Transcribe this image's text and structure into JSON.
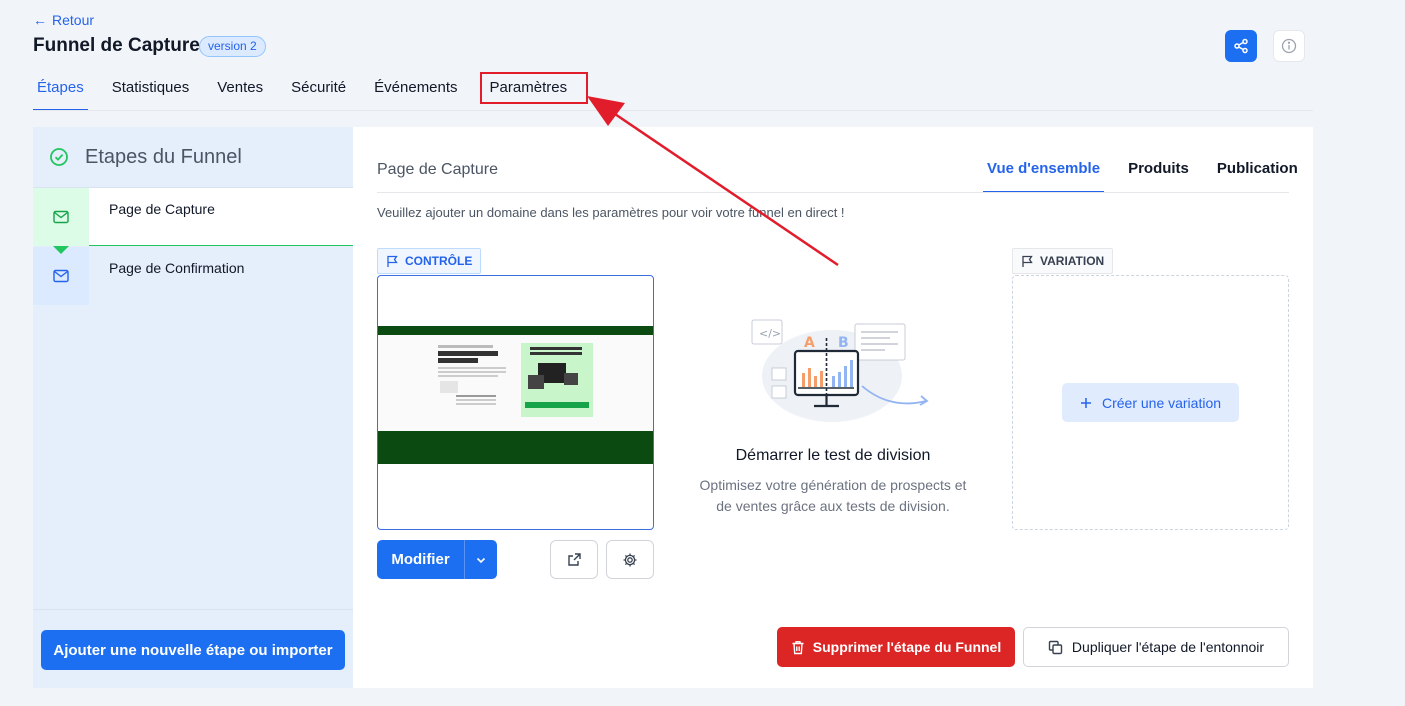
{
  "header": {
    "back_label": "Retour",
    "title": "Funnel de Capture",
    "version_badge": "version 2"
  },
  "top_tabs": [
    {
      "label": "Étapes",
      "active": true
    },
    {
      "label": "Statistiques",
      "active": false
    },
    {
      "label": "Ventes",
      "active": false
    },
    {
      "label": "Sécurité",
      "active": false
    },
    {
      "label": "Événements",
      "active": false
    },
    {
      "label": "Paramètres",
      "active": false,
      "highlighted": true
    }
  ],
  "sidebar": {
    "title": "Etapes du Funnel",
    "steps": [
      {
        "label": "Page de Capture",
        "selected": true
      },
      {
        "label": "Page de Confirmation",
        "selected": false
      }
    ],
    "add_button": "Ajouter une nouvelle étape ou importer"
  },
  "main": {
    "page_title": "Page de Capture",
    "tabs": [
      {
        "label": "Vue d'ensemble",
        "active": true
      },
      {
        "label": "Produits",
        "active": false
      },
      {
        "label": "Publication",
        "active": false
      }
    ],
    "notice": "Veuillez ajouter un domaine dans les paramètres pour voir votre funnel en direct !",
    "control_tag": "CONTRÔLE",
    "variation_tag": "VARIATION",
    "modify_button": "Modifier",
    "split_test": {
      "title": "Démarrer le test de division",
      "description": "Optimisez votre génération de prospects et de ventes grâce aux tests de division.",
      "label_a": "A",
      "label_b": "B"
    },
    "create_variation_button": "Créer une variation",
    "delete_button": "Supprimer l'étape du Funnel",
    "duplicate_button": "Dupliquer l'étape de l'entonnoir"
  },
  "colors": {
    "primary": "#1d6ff2",
    "danger": "#dc2626",
    "success": "#22c55e",
    "annotation": "#e11d2c"
  }
}
